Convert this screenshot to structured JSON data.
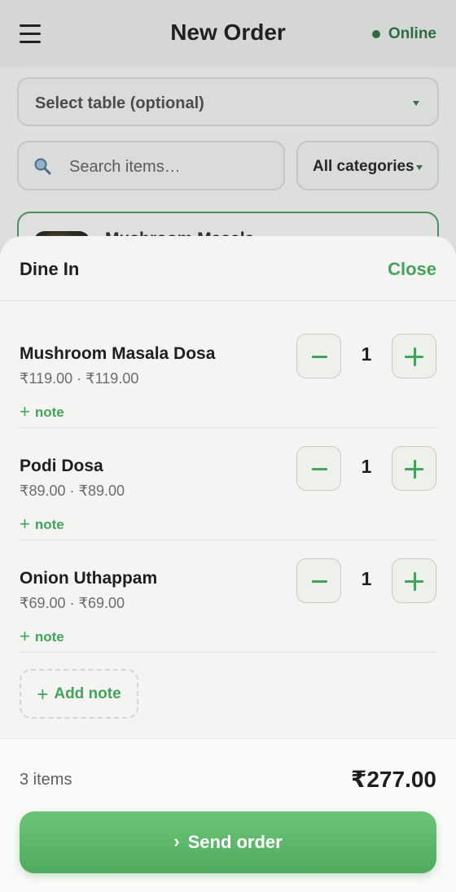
{
  "header": {
    "title": "New Order",
    "status": "Online",
    "status_color": "#2f6b45"
  },
  "filters": {
    "table_select": "Select table (optional)",
    "search_placeholder": "Search items…",
    "category_select": "All categories"
  },
  "background_item": {
    "name": "Mushroom Masala"
  },
  "sheet": {
    "title": "Dine In",
    "close_label": "Close",
    "note_label": "note",
    "items": [
      {
        "name": "Mushroom Masala Dosa",
        "price": "₹119.00 · ₹119.00",
        "qty": "1"
      },
      {
        "name": "Podi Dosa",
        "price": "₹89.00 · ₹89.00",
        "qty": "1"
      },
      {
        "name": "Onion Uthappam",
        "price": "₹69.00 · ₹69.00",
        "qty": "1"
      }
    ],
    "add_note_label": "Add note"
  },
  "footer": {
    "count": "3 items",
    "total": "₹277.00",
    "send_label": "Send order"
  },
  "colors": {
    "accent": "#43a35a",
    "button": "#5cb66a"
  }
}
